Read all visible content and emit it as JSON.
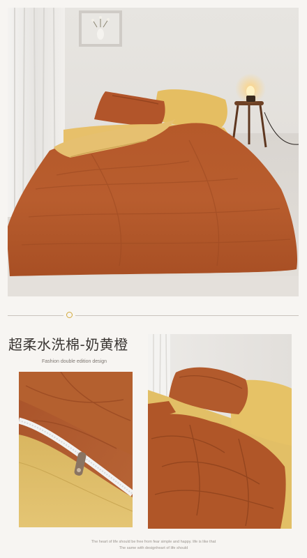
{
  "product": {
    "title": "超柔水洗棉-奶黄橙",
    "subtitle": "Fashion double edition design"
  },
  "footer": {
    "line1": "The heart of life should be free from fear simple and happy. life is like that",
    "line2": "The same with designheart of life should"
  },
  "colors": {
    "rust": "#b35a2a",
    "mustard": "#e0b95a",
    "background": "#f7f5f2",
    "accent_gold": "#d2a93a"
  }
}
